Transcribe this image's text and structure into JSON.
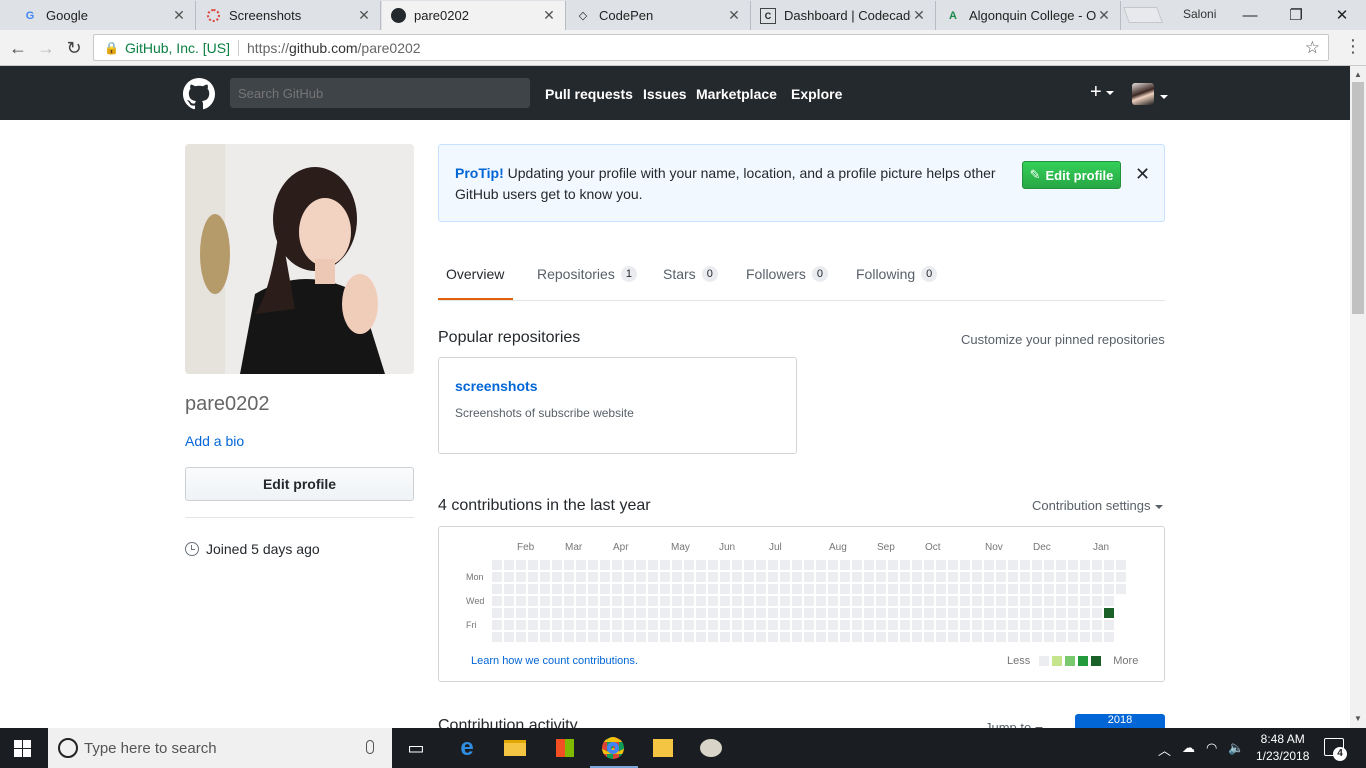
{
  "browser": {
    "tabs": [
      {
        "title": "Google",
        "icon": "google-favicon"
      },
      {
        "title": "Screenshots",
        "icon": "spinner-favicon"
      },
      {
        "title": "pare0202",
        "icon": "github-favicon"
      },
      {
        "title": "CodePen",
        "icon": "codepen-favicon"
      },
      {
        "title": "Dashboard | Codecader",
        "icon": "codecademy-favicon"
      },
      {
        "title": "Algonquin College - O",
        "icon": "algonquin-favicon"
      }
    ],
    "window_user": "Saloni",
    "site_identity": "GitHub, Inc. [US]",
    "url_scheme": "https://",
    "url_host": "github.com",
    "url_path": "/pare0202"
  },
  "gh": {
    "search_placeholder": "Search GitHub",
    "nav": [
      "Pull requests",
      "Issues",
      "Marketplace",
      "Explore"
    ],
    "plus": "+"
  },
  "profile": {
    "username": "pare0202",
    "add_bio": "Add a bio",
    "edit_profile": "Edit profile",
    "joined": "Joined 5 days ago"
  },
  "protip": {
    "label": "ProTip!",
    "text": " Updating your profile with your name, location, and a profile picture helps other GitHub users get to know you.",
    "button": "Edit profile",
    "close": "✕"
  },
  "tabs": [
    {
      "label": "Overview",
      "count": ""
    },
    {
      "label": "Repositories",
      "count": "1"
    },
    {
      "label": "Stars",
      "count": "0"
    },
    {
      "label": "Followers",
      "count": "0"
    },
    {
      "label": "Following",
      "count": "0"
    }
  ],
  "popular": {
    "title": "Popular repositories",
    "customize": "Customize your pinned repositories",
    "repo_name": "screenshots",
    "repo_desc": "Screenshots of subscribe website"
  },
  "contributions": {
    "title": "4 contributions in the last year",
    "settings": "Contribution settings",
    "months": [
      "Feb",
      "Mar",
      "Apr",
      "May",
      "Jun",
      "Jul",
      "Aug",
      "Sep",
      "Oct",
      "Nov",
      "Dec",
      "Jan"
    ],
    "days": [
      "Mon",
      "Wed",
      "Fri"
    ],
    "learn": "Learn how we count contributions.",
    "less": "Less",
    "more": "More",
    "colors": [
      "#ebedf0",
      "#c6e48b",
      "#7bc96f",
      "#239a3b",
      "#196127"
    ]
  },
  "activity": {
    "title": "Contribution activity",
    "jump": "Jump to",
    "year": "2018"
  },
  "taskbar": {
    "search_placeholder": "Type here to search",
    "time": "8:48 AM",
    "date": "1/23/2018",
    "notifications": "4"
  }
}
